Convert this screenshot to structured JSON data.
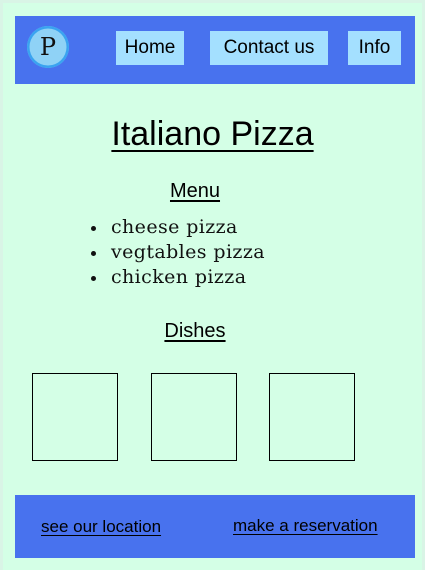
{
  "logo": {
    "letter": "P",
    "icon": "logo-icon"
  },
  "nav": {
    "home": "Home",
    "contact": "Contact us",
    "info": "Info"
  },
  "main": {
    "title": "Italiano Pizza",
    "menu_heading": "Menu",
    "menu_items": [
      "cheese pizza",
      "vegtables pizza",
      "chicken pizza"
    ],
    "dishes_heading": "Dishes"
  },
  "footer": {
    "location_link": "see our location",
    "reservation_link": "make a reservation"
  },
  "colors": {
    "background": "#d4ffe6",
    "bar": "#4872ee",
    "nav_button": "#a4e0ff",
    "logo": "#8fd2f6"
  }
}
